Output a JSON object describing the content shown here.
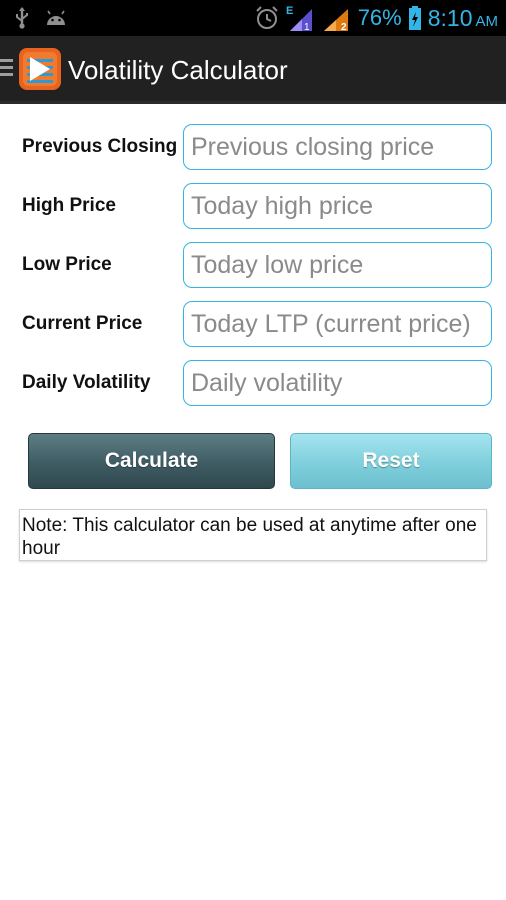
{
  "status_bar": {
    "battery_percent": "76%",
    "time": "8:10",
    "ampm": "AM",
    "network_label": "E",
    "sim2_label": "2",
    "accent_color": "#33b5e5"
  },
  "app_bar": {
    "title": "Volatility Calculator",
    "icon": "app-logo-icon"
  },
  "form": {
    "fields": [
      {
        "label": "Previous Closing",
        "placeholder": "Previous closing price",
        "value": ""
      },
      {
        "label": "High Price",
        "placeholder": "Today high price",
        "value": ""
      },
      {
        "label": "Low Price",
        "placeholder": "Today low price",
        "value": ""
      },
      {
        "label": "Current Price",
        "placeholder": "Today LTP (current price)",
        "value": ""
      },
      {
        "label": "Daily Volatility",
        "placeholder": "Daily volatility",
        "value": ""
      }
    ]
  },
  "buttons": {
    "calculate": "Calculate",
    "reset": "Reset"
  },
  "note": "Note: This calculator can be used at anytime after one hour"
}
